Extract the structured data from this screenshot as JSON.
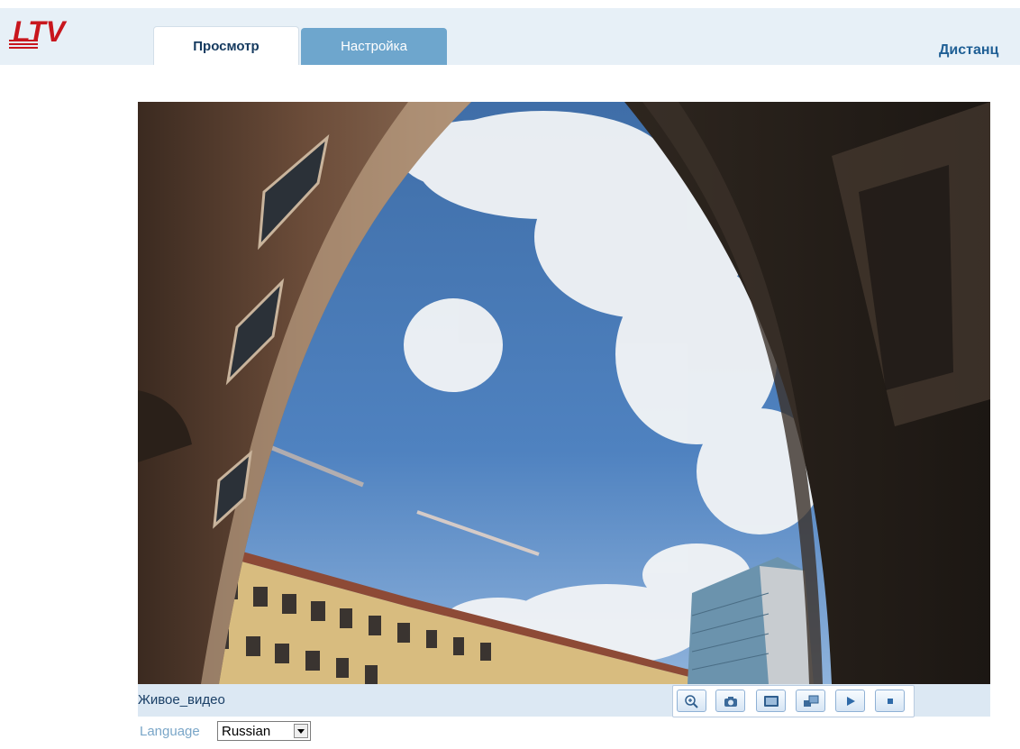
{
  "header": {
    "logo": "LTV",
    "tabs": [
      {
        "label": "Просмотр",
        "active": true
      },
      {
        "label": "Настройка",
        "active": false
      }
    ],
    "remote_link": "Дистанц"
  },
  "video": {
    "stream_label": "Живое_видео"
  },
  "controls": {
    "buttons": [
      "zoom-icon",
      "camera-icon",
      "fullscreen-icon",
      "resize-icon",
      "play-icon",
      "stop-icon"
    ]
  },
  "language": {
    "label": "Language",
    "selected": "Russian"
  },
  "colors": {
    "header_bg": "#e7f0f7",
    "tab_inactive": "#6ea6cd",
    "accent": "#1f5f95",
    "logo_red": "#c8161d"
  }
}
